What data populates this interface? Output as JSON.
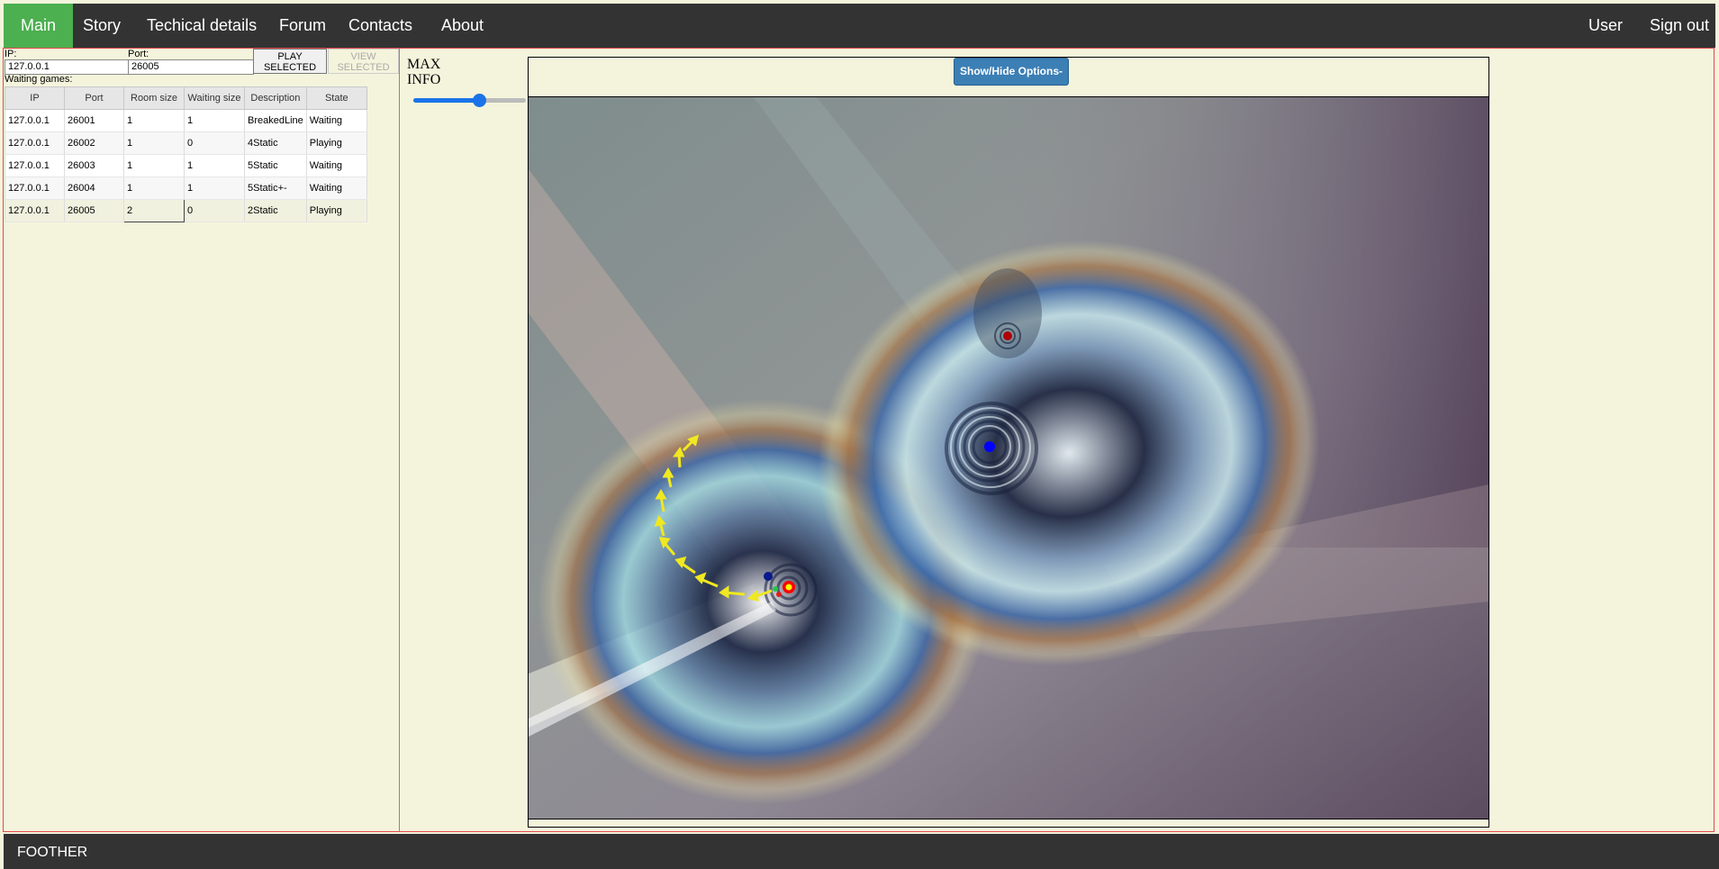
{
  "nav": {
    "left": [
      "Main",
      "Story",
      "Techical details",
      "Forum",
      "Contacts",
      "About"
    ],
    "right": [
      "User",
      "Sign out"
    ],
    "active_color": "#4caf50",
    "bar_color": "#333333"
  },
  "connect": {
    "ip_label": "IP:",
    "ip_value": "127.0.0.1",
    "port_label": "Port:",
    "port_value": "26005",
    "play_label": "PLAY\nSELECTED",
    "view_label": "VIEW\nSELECTED"
  },
  "games": {
    "title": "Waiting games:",
    "columns": [
      "IP",
      "Port",
      "Room size",
      "Waiting size",
      "Description",
      "State"
    ],
    "rows": [
      [
        "127.0.0.1",
        "26001",
        "1",
        "1",
        "BreakedLine",
        "Waiting"
      ],
      [
        "127.0.0.1",
        "26002",
        "1",
        "0",
        "4Static",
        "Playing"
      ],
      [
        "127.0.0.1",
        "26003",
        "1",
        "1",
        "5Static",
        "Waiting"
      ],
      [
        "127.0.0.1",
        "26004",
        "1",
        "1",
        "5Static+-",
        "Waiting"
      ],
      [
        "127.0.0.1",
        "26005",
        "2",
        "0",
        "2Static",
        "Playing"
      ]
    ],
    "selected_row": 4
  },
  "info": {
    "line1": "MAX",
    "line2": "INFO",
    "slider_value": 0.58
  },
  "game": {
    "options_button": "Show/Hide Options-",
    "accent": "#3c7fb5"
  },
  "footer": {
    "text": "FOOTHER"
  }
}
